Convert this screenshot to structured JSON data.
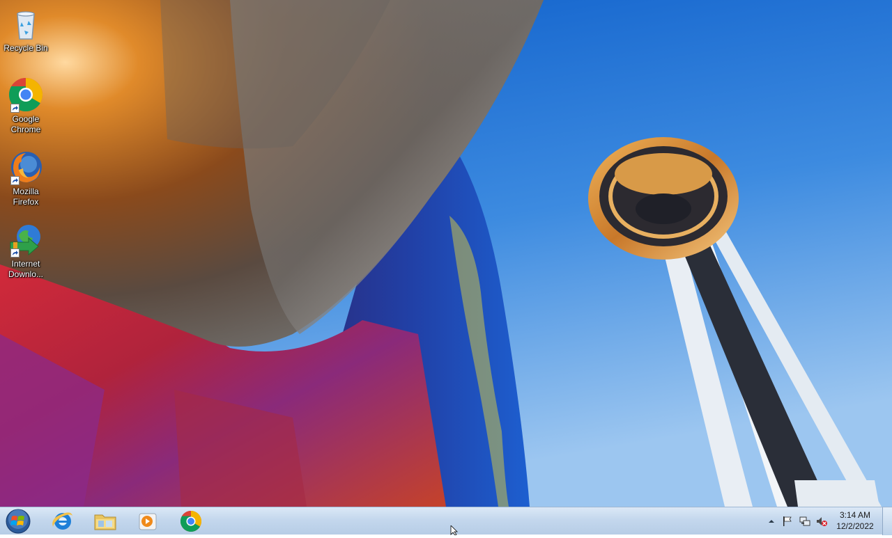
{
  "desktop": {
    "icons": [
      {
        "label": "Recycle Bin",
        "icon": "recycle-bin-icon"
      },
      {
        "label": "Google Chrome",
        "icon": "chrome-icon"
      },
      {
        "label": "Mozilla Firefox",
        "icon": "firefox-icon"
      },
      {
        "label": "Internet Downlo...",
        "icon": "internet-download-manager-icon"
      }
    ]
  },
  "taskbar": {
    "start": {
      "icon": "windows-start-icon"
    },
    "pinned_apps": [
      {
        "icon": "internet-explorer-icon"
      },
      {
        "icon": "file-explorer-icon"
      },
      {
        "icon": "windows-media-player-icon"
      },
      {
        "icon": "chrome-icon"
      }
    ],
    "tray": {
      "icons": [
        "show-hidden-icons-arrow",
        "action-center-flag-icon",
        "network-icon",
        "volume-muted-icon"
      ],
      "time": "3:14 AM",
      "date": "12/2/2022"
    }
  },
  "colors": {
    "sky": "#1f73d6",
    "taskbar": "#c4d7ed"
  }
}
